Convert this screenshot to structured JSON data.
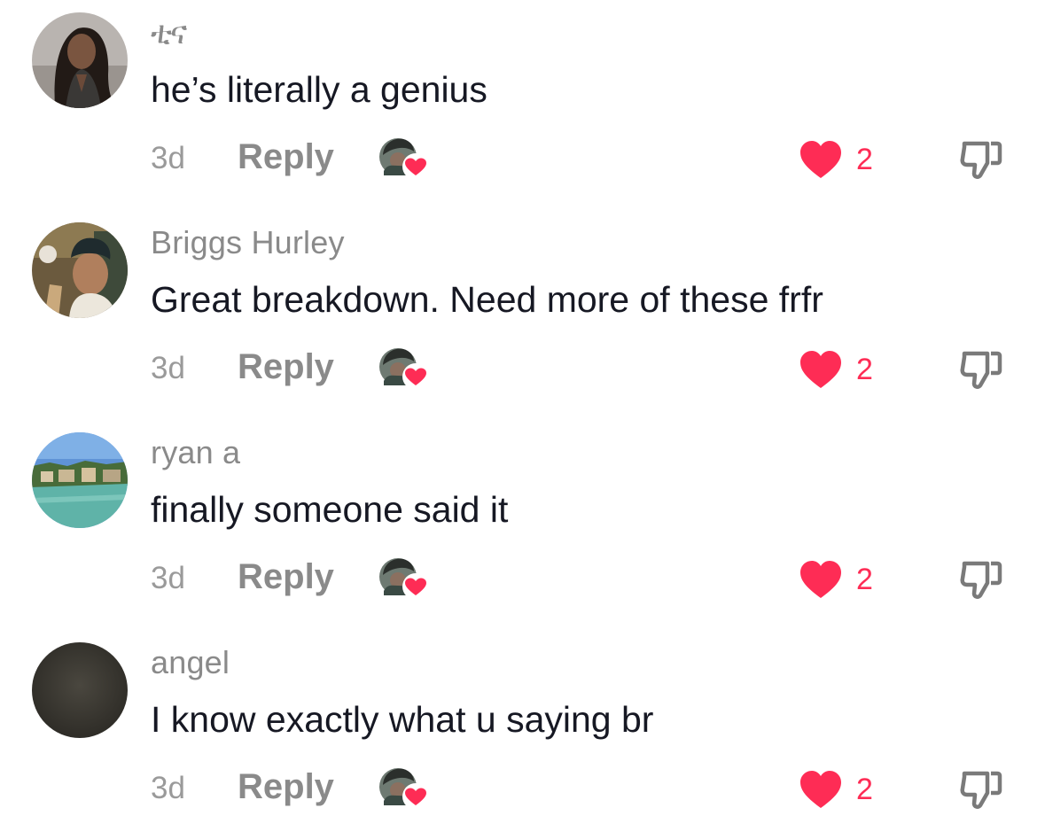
{
  "colors": {
    "like": "#fe2c55",
    "secondary_text": "#8a8a8a",
    "primary_text": "#161823"
  },
  "icons": {
    "like": "heart-icon",
    "dislike": "thumbs-down-icon",
    "creator_liked": "creator-liked-icon"
  },
  "comments": [
    {
      "username": "ቲና",
      "text": "he’s literally a genius",
      "time": "3d",
      "reply_label": "Reply",
      "likes": "2"
    },
    {
      "username": "Briggs Hurley",
      "text": "Great breakdown. Need more of these frfr",
      "time": "3d",
      "reply_label": "Reply",
      "likes": "2"
    },
    {
      "username": "ryan a",
      "text": "finally someone said it",
      "time": "3d",
      "reply_label": "Reply",
      "likes": "2"
    },
    {
      "username": "angel",
      "text": "I know exactly what u saying br",
      "time": "3d",
      "reply_label": "Reply",
      "likes": "2"
    }
  ]
}
